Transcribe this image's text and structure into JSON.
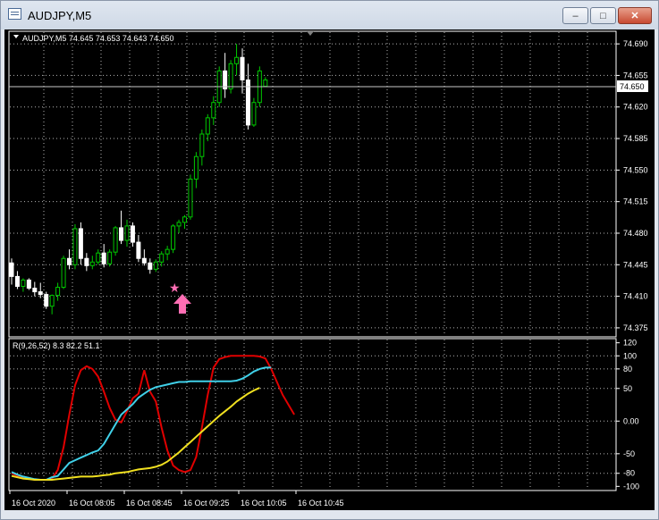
{
  "window": {
    "title": "AUDJPY,M5",
    "buttons": {
      "minimize": "–",
      "maximize": "□",
      "close": "✕"
    }
  },
  "main_chart": {
    "header": "AUDJPY,M5  74.645 74.653 74.643 74.650",
    "current_price_label": "74.650",
    "price_ticks": [
      "74.690",
      "74.655",
      "74.620",
      "74.585",
      "74.550",
      "74.515",
      "74.480",
      "74.445",
      "74.410",
      "74.375"
    ],
    "markers": {
      "star": "★",
      "arrow": "buy-arrow-icon"
    }
  },
  "indicator": {
    "header": "R(9,26,52) 8.3 82.2 51.1",
    "ticks": [
      "120",
      "100",
      "80",
      "50",
      "0.00",
      "-50",
      "-80",
      "-100"
    ]
  },
  "time_labels": [
    "16 Oct 2020",
    "16 Oct 08:05",
    "16 Oct 08:45",
    "16 Oct 09:25",
    "16 Oct 10:05",
    "16 Oct 10:45"
  ],
  "colors": {
    "bull_candle": "#00c800",
    "bear_candle": "#ffffff",
    "grid": "#b4b4b4",
    "red_line": "#e00000",
    "cyan_line": "#40d0e8",
    "yellow_line": "#f0e020",
    "marker": "#ff6eb4"
  },
  "chart_data": {
    "type": "candlestick",
    "symbol": "AUDJPY",
    "timeframe": "M5",
    "ohlc": [
      [
        74.447,
        74.452,
        74.423,
        74.432
      ],
      [
        74.432,
        74.438,
        74.418,
        74.421
      ],
      [
        74.421,
        74.43,
        74.415,
        74.428
      ],
      [
        74.428,
        74.43,
        74.417,
        74.419
      ],
      [
        74.419,
        74.426,
        74.41,
        74.415
      ],
      [
        74.415,
        74.425,
        74.408,
        74.412
      ],
      [
        74.412,
        74.415,
        74.396,
        74.399
      ],
      [
        74.399,
        74.412,
        74.39,
        74.411
      ],
      [
        74.411,
        74.425,
        74.405,
        74.42
      ],
      [
        74.42,
        74.455,
        74.418,
        74.452
      ],
      [
        74.452,
        74.462,
        74.44,
        74.445
      ],
      [
        74.445,
        74.49,
        74.44,
        74.485
      ],
      [
        74.485,
        74.492,
        74.445,
        74.452
      ],
      [
        74.452,
        74.458,
        74.438,
        74.444
      ],
      [
        74.444,
        74.455,
        74.44,
        74.448
      ],
      [
        74.448,
        74.462,
        74.445,
        74.458
      ],
      [
        74.458,
        74.468,
        74.442,
        74.446
      ],
      [
        74.446,
        74.462,
        74.443,
        74.459
      ],
      [
        74.459,
        74.488,
        74.455,
        74.486
      ],
      [
        74.486,
        74.505,
        74.468,
        74.472
      ],
      [
        74.472,
        74.495,
        74.465,
        74.488
      ],
      [
        74.488,
        74.492,
        74.465,
        74.47
      ],
      [
        74.47,
        74.478,
        74.448,
        74.452
      ],
      [
        74.452,
        74.462,
        74.444,
        74.447
      ],
      [
        74.447,
        74.452,
        74.435,
        74.44
      ],
      [
        74.44,
        74.451,
        74.437,
        74.448
      ],
      [
        74.448,
        74.46,
        74.443,
        74.457
      ],
      [
        74.457,
        74.466,
        74.45,
        74.462
      ],
      [
        74.462,
        74.49,
        74.458,
        74.488
      ],
      [
        74.488,
        74.495,
        74.48,
        74.492
      ],
      [
        74.492,
        74.5,
        74.485,
        74.498
      ],
      [
        74.498,
        74.545,
        74.495,
        74.54
      ],
      [
        74.54,
        74.57,
        74.53,
        74.565
      ],
      [
        74.565,
        74.595,
        74.555,
        74.59
      ],
      [
        74.59,
        74.612,
        74.582,
        74.608
      ],
      [
        74.608,
        74.632,
        74.6,
        74.625
      ],
      [
        74.625,
        74.665,
        74.62,
        74.66
      ],
      [
        74.66,
        74.68,
        74.63,
        74.64
      ],
      [
        74.64,
        74.672,
        74.635,
        74.668
      ],
      [
        74.668,
        74.69,
        74.655,
        74.675
      ],
      [
        74.675,
        74.685,
        74.635,
        74.65
      ],
      [
        74.65,
        74.668,
        74.595,
        74.6
      ],
      [
        74.6,
        74.63,
        74.598,
        74.625
      ],
      [
        74.625,
        74.665,
        74.62,
        74.66
      ],
      [
        74.643,
        74.653,
        74.643,
        74.65
      ]
    ],
    "price_range": [
      74.366,
      74.703
    ],
    "indicator_series": [
      {
        "name": "red",
        "color": "#e00000",
        "values": [
          -80,
          -84,
          -86,
          -88,
          -90,
          -90,
          -90,
          -88,
          -75,
          -40,
          10,
          55,
          78,
          84,
          80,
          68,
          45,
          20,
          2,
          -2,
          15,
          35,
          42,
          78,
          45,
          30,
          -10,
          -45,
          -68,
          -75,
          -78,
          -75,
          -55,
          -10,
          40,
          82,
          95,
          98,
          100,
          100,
          100,
          100,
          100,
          99,
          96,
          80,
          60,
          40,
          25,
          10
        ]
      },
      {
        "name": "cyan",
        "color": "#40d0e8",
        "values": [
          -78,
          -82,
          -85,
          -87,
          -89,
          -90,
          -90,
          -86,
          -84,
          -74,
          -64,
          -60,
          -56,
          -52,
          -48,
          -45,
          -35,
          -20,
          -5,
          10,
          18,
          26,
          36,
          42,
          48,
          52,
          54,
          56,
          58,
          60,
          60,
          61,
          61,
          61,
          61,
          61,
          61,
          61,
          61,
          62,
          65,
          70,
          76,
          80,
          82,
          82
        ]
      },
      {
        "name": "yellow",
        "color": "#f0e020",
        "values": [
          -84,
          -86,
          -88,
          -89,
          -90,
          -90,
          -90,
          -90,
          -89,
          -88,
          -87,
          -86,
          -85,
          -85,
          -85,
          -84,
          -83,
          -82,
          -80,
          -79,
          -78,
          -76,
          -74,
          -73,
          -72,
          -70,
          -67,
          -62,
          -55,
          -48,
          -40,
          -32,
          -24,
          -16,
          -8,
          0,
          8,
          15,
          22,
          30,
          36,
          42,
          47,
          51
        ]
      }
    ],
    "indicator_range": [
      -105,
      125
    ]
  }
}
